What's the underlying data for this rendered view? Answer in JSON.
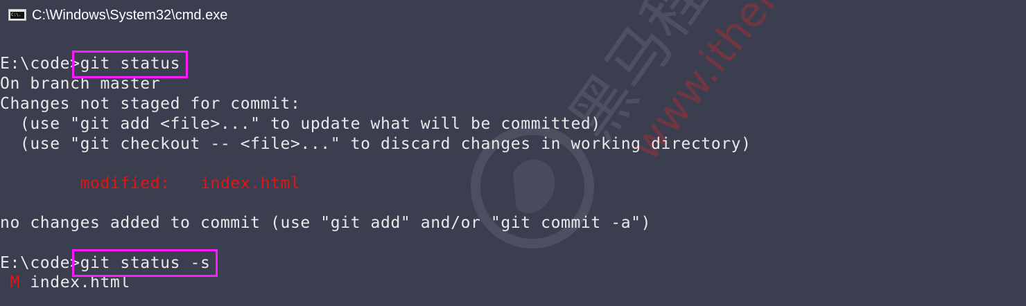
{
  "window": {
    "title": "C:\\Windows\\System32\\cmd.exe",
    "icon": "console-app-icon",
    "icon_text": "C:\\."
  },
  "terminal": {
    "prompt1": "E:\\code>",
    "command1": "git status",
    "output": {
      "branch_line": "On branch master",
      "changes_header": "Changes not staged for commit:",
      "hint_add": "  (use \"git add <file>...\" to update what will be committed)",
      "hint_checkout": "  (use \"git checkout -- <file>...\" to discard changes in working directory)",
      "modified_label": "        modified:   ",
      "modified_file": "index.html",
      "summary": "no changes added to commit (use \"git add\" and/or \"git commit -a\")"
    },
    "prompt2": "E:\\code>",
    "command2": "git status -s",
    "short_status": {
      "flag": " M",
      "file": " index.html"
    }
  },
  "watermark": {
    "text_url": "www.itheima.",
    "text_cn": "黑马程"
  },
  "colors": {
    "background": "#3a3e4f",
    "text": "#e8e8e8",
    "modified": "#e01515",
    "highlight_box": "#ff1aff"
  }
}
